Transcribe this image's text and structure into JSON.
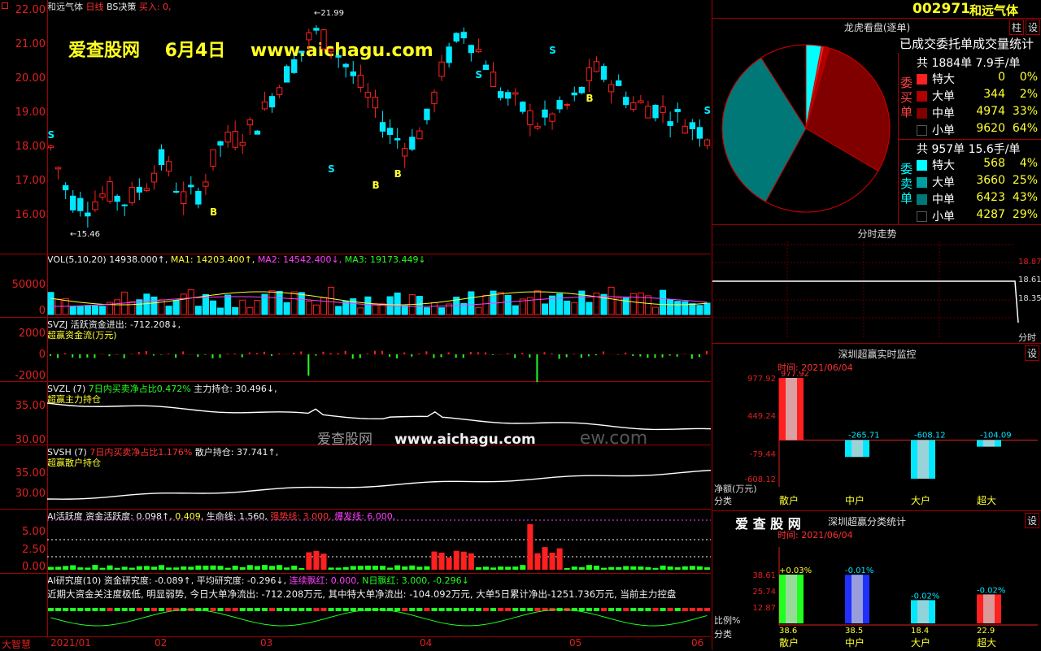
{
  "header": {
    "stock_name": "和远气体",
    "period": "日线",
    "strategy": "BS决策",
    "buy_signal": "买入: 0,",
    "watermark_site": "爱查股网",
    "watermark_date": "6月4日",
    "watermark_url": "www.aichagu.com",
    "overlay_site": "爱查股网",
    "overlay_url": "www.aichagu.com",
    "overlay_url2": "ew.com"
  },
  "price_axis": [
    "22.00",
    "21.00",
    "20.00",
    "19.00",
    "18.00",
    "17.00",
    "16.00"
  ],
  "markers": {
    "high": "21.99",
    "low": "15.46"
  },
  "vol_panel": {
    "line": "VOL(5,10,20)",
    "v1": "14938.000↑,",
    "ma1": "MA1: 14203.400↑,",
    "ma2": "MA2: 14542.400↓,",
    "ma3": "MA3: 19173.449↓",
    "ticks": [
      "50000",
      "0"
    ]
  },
  "svzj_panel": {
    "line": "SVZJ  活跃资金进出: -712.208↓,",
    "sub": "超赢资金流(万元)",
    "ticks": [
      "2000",
      "0",
      "-2000"
    ]
  },
  "svzl_panel": {
    "line": "SVZL (7)",
    "ratio": "7日内买卖净占比0.472%",
    "main": "主力持仓: 30.496↓,",
    "sub": "超赢主力持仓",
    "ticks": [
      "35.00",
      "30.00"
    ]
  },
  "svsh_panel": {
    "line": "SVSH (7)",
    "ratio": "7日内买卖净占比1.176%",
    "retail": "散户持仓: 37.741↑,",
    "sub": "超赢散户持仓",
    "ticks": [
      "35.00",
      "30.00"
    ]
  },
  "ai_panel": {
    "title": "AI活跃度",
    "a": "资金活跃度: 0.098↑,",
    "b": "0.409,",
    "c": "生命线: 1.560,",
    "d": "强势线: 3.000,",
    "e": "爆发线: 6.000,",
    "ticks": [
      "5.00",
      "2.50",
      "0.00"
    ]
  },
  "research_panel": {
    "line": "AI研究度(10) 资金研究度: -0.089↑, 平均研究度: -0.296↓,",
    "l2": "连续飘红: 0.000,",
    "l3": "N日飘红: 3.000, -0.296↓",
    "text": "近期大资金关注度极低, 明显弱势, 今日大单净流出: -712.208万元, 其中特大单净流出: -104.092万元, 大单5日累计净出-1251.736万元, 当前主力控盘"
  },
  "xaxis": {
    "corner": "大智慧",
    "labels": [
      "2021/01",
      "02",
      "03",
      "04",
      "05",
      "06"
    ]
  },
  "quote": {
    "code": "002971",
    "name": "和远气体",
    "btn1": "柱",
    "btn2": "设"
  },
  "dragon": {
    "title": "龙虎看盘(逐单)",
    "subtitle": "已成交委托单成交量统计",
    "buy_label": "委买单",
    "buy_total": "共 1884单 7.9手/单",
    "buy_rows": [
      {
        "label": "特大",
        "count": "0",
        "pct": "0%",
        "color": "#ff2020"
      },
      {
        "label": "大单",
        "count": "344",
        "pct": "2%",
        "color": "#b00000"
      },
      {
        "label": "中单",
        "count": "4974",
        "pct": "33%",
        "color": "#800000"
      },
      {
        "label": "小单",
        "count": "9620",
        "pct": "64%",
        "color": "#000000"
      }
    ],
    "sell_label": "委卖单",
    "sell_total": "共 957单 15.6手/单",
    "sell_rows": [
      {
        "label": "特大",
        "count": "568",
        "pct": "4%",
        "color": "#00ffff"
      },
      {
        "label": "大单",
        "count": "3660",
        "pct": "25%",
        "color": "#00a0a0"
      },
      {
        "label": "中单",
        "count": "6423",
        "pct": "43%",
        "color": "#007878"
      },
      {
        "label": "小单",
        "count": "4287",
        "pct": "29%",
        "color": "#000000"
      }
    ]
  },
  "intraday": {
    "title": "分时走势",
    "ticks": [
      "18.87",
      "18.61",
      "18.35"
    ],
    "tail": "分时"
  },
  "monitor": {
    "title": "深圳超赢实时监控",
    "btn": "设",
    "time": "时间: 2021/06/04",
    "yticks": [
      "977.92",
      "449.24",
      "-79.44",
      "-608.12"
    ],
    "ylabel": "净额(万元)",
    "xlabel": "分类",
    "bars": [
      {
        "label": "散户",
        "value": "977.92",
        "num": 977.92,
        "color": "#ff2020"
      },
      {
        "label": "中户",
        "value": "-265.71",
        "num": -265.71,
        "color": "#00e8ff"
      },
      {
        "label": "大户",
        "value": "-608.12",
        "num": -608.12,
        "color": "#00e8ff"
      },
      {
        "label": "超大",
        "value": "-104.09",
        "num": -104.09,
        "color": "#00e8ff"
      }
    ]
  },
  "classify": {
    "title": "深圳超赢分类统计",
    "brand": "爱 查 股 网",
    "btn": "设",
    "time": "时间: 2021/06/04",
    "yticks": [
      "38.61",
      "25.74",
      "12.87"
    ],
    "ylabel": "比例%",
    "xlabel": "分类",
    "bars": [
      {
        "label": "散户",
        "top": "+0.03%",
        "bottom": "38.6",
        "num": 38.6,
        "color": "#20ff20"
      },
      {
        "label": "中户",
        "top": "-0.01%",
        "bottom": "38.5",
        "num": 38.5,
        "color": "#2030ff"
      },
      {
        "label": "大户",
        "top": "-0.02%",
        "bottom": "18.4",
        "num": 18.4,
        "color": "#00e8ff"
      },
      {
        "label": "超大",
        "top": "-0.02%",
        "bottom": "22.9",
        "num": 22.9,
        "color": "#ff2020"
      }
    ]
  },
  "chart_data": {
    "type": "bar",
    "title": "深圳超赢实时监控",
    "categories": [
      "散户",
      "中户",
      "大户",
      "超大"
    ],
    "values": [
      977.92,
      -265.71,
      -608.12,
      -104.09
    ],
    "ylabel": "净额(万元)",
    "ylim": [
      -608.12,
      977.92
    ]
  }
}
